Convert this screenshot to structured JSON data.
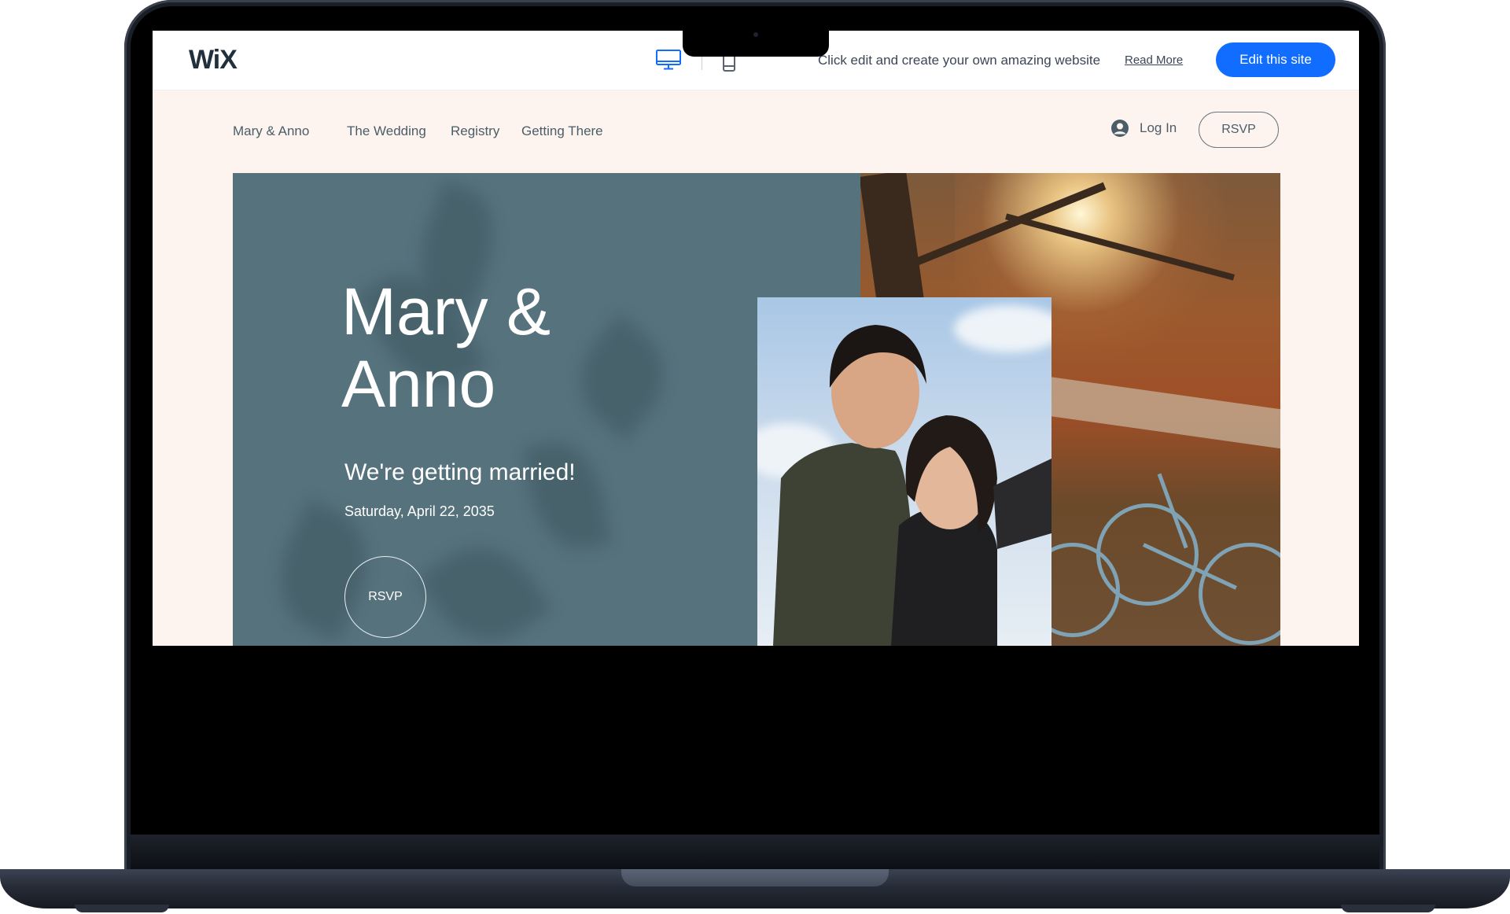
{
  "wix_bar": {
    "logo": "WiX",
    "message": "Click edit and create your own amazing website",
    "read_more": "Read More",
    "edit_button": "Edit this site",
    "icons": [
      "desktop-icon",
      "mobile-icon"
    ]
  },
  "nav": {
    "items": [
      {
        "label": "Mary & Anno"
      },
      {
        "label": "The Wedding"
      },
      {
        "label": "Registry"
      },
      {
        "label": "Getting There"
      }
    ],
    "login": "Log In",
    "rsvp": "RSVP"
  },
  "hero": {
    "title_line1": "Mary &",
    "title_line2": "Anno",
    "subtitle": "We're getting married!",
    "date": "Saturday, April 22, 2035",
    "rsvp": "RSVP"
  },
  "colors": {
    "accent": "#116dff",
    "hero_panel": "#56727d",
    "page_bg": "#fdf4ef",
    "nav_text": "#4b5d68"
  }
}
